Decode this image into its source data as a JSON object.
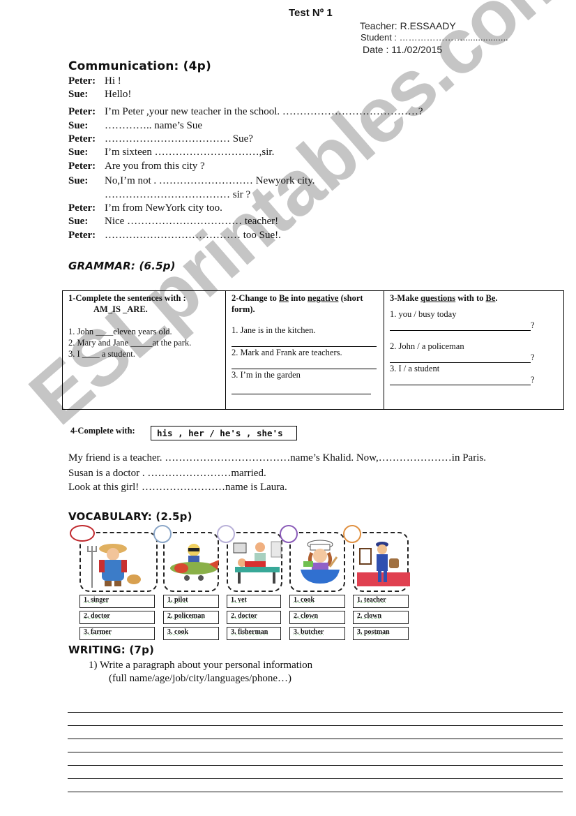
{
  "header": {
    "title": "Test  Nº 1",
    "teacher": "Teacher: R.ESSAADY",
    "student": "Student : …………………..................",
    "date": "Date    : 11./02/2015"
  },
  "communication": {
    "heading": "Communication: (4p)",
    "lines": [
      {
        "speaker": "Peter:",
        "text": "Hi  !"
      },
      {
        "speaker": "Sue:",
        "text": "Hello!"
      },
      {
        "speaker": "Peter:",
        "text": "I’m Peter ,your new teacher in the school.      …………………………………?"
      },
      {
        "speaker": "Sue:",
        "text": "………….. name’s Sue"
      },
      {
        "speaker": "Peter:",
        "text": "……………………………… Sue?"
      },
      {
        "speaker": "Sue:",
        "text": "I’m sixteen …………………………,sir."
      },
      {
        "speaker": "Peter:",
        "text": "Are you from this city ?"
      },
      {
        "speaker": "Sue:",
        "text": "No,I’m not .   ……………………… Newyork city."
      },
      {
        "speaker": "",
        "text": "……………………………… sir ?"
      },
      {
        "speaker": "Peter:",
        "text": "I’m from NewYork city too."
      },
      {
        "speaker": "Sue:",
        "text": "Nice …………………………… teacher!"
      },
      {
        "speaker": "Peter:",
        "text": "………………………………… too Sue!."
      }
    ]
  },
  "grammar": {
    "heading": "GRAMMAR: (6.5p)",
    "col1": {
      "title": "1-Complete the sentences with :",
      "subtitle": "AM_IS _ARE.",
      "items": [
        "1. John ____eleven years old.",
        "2. Mary and Jane _____at the park.",
        "3. I ____ a student."
      ]
    },
    "col2": {
      "title_a": "2-Change to ",
      "title_be": "Be",
      "title_b": " into ",
      "title_neg": "negative",
      "title_c": " (short form).",
      "items": [
        "1. Jane is in the kitchen.",
        "2. Mark and Frank are teachers.",
        "3.  I’m in the garden"
      ]
    },
    "col3": {
      "title_a": "3-Make ",
      "title_q": "questions",
      "title_b": " with to ",
      "title_be": "Be",
      "title_c": ".",
      "items": [
        "1.  you / busy today",
        "2. John / a policeman",
        "3.  I / a student"
      ],
      "qmark": "?"
    }
  },
  "complete_with": {
    "label": "4-Complete with:",
    "words": "his , her / he's , she's",
    "sentences": [
      "My friend is a teacher.  ………………………………name’s Khalid. Now,…………………in Paris.",
      "Susan is a doctor .  ……………………married.",
      "Look at this girl! ……………………name is Laura."
    ]
  },
  "vocabulary": {
    "heading": "VOCABULARY: (2.5p)",
    "cards": [
      {
        "picture": "farmer-picture",
        "circle_color": "#c0282d",
        "options": [
          "1. singer",
          "2. doctor",
          "3. farmer"
        ]
      },
      {
        "picture": "pilot-picture",
        "circle_color": "#8aa6c8",
        "options": [
          "1. pilot",
          "2. policeman",
          "3. cook"
        ]
      },
      {
        "picture": "doctor-picture",
        "circle_color": "#b8b0d8",
        "options": [
          "1. vet",
          "2. doctor",
          "3. fisherman"
        ]
      },
      {
        "picture": "cook-picture",
        "circle_color": "#8a5bb8",
        "options": [
          "1. cook",
          "2. clown",
          "3. butcher"
        ]
      },
      {
        "picture": "postman-picture",
        "circle_color": "#e09040",
        "options": [
          "1. teacher",
          "2. clown",
          "3. postman"
        ]
      }
    ]
  },
  "writing": {
    "heading": "WRITING: (7p)",
    "task": "1)  Write a paragraph about your personal information",
    "hint": "(full name/age/job/city/languages/phone…)",
    "line_count": 7
  },
  "watermark": "ESLprintables.com"
}
